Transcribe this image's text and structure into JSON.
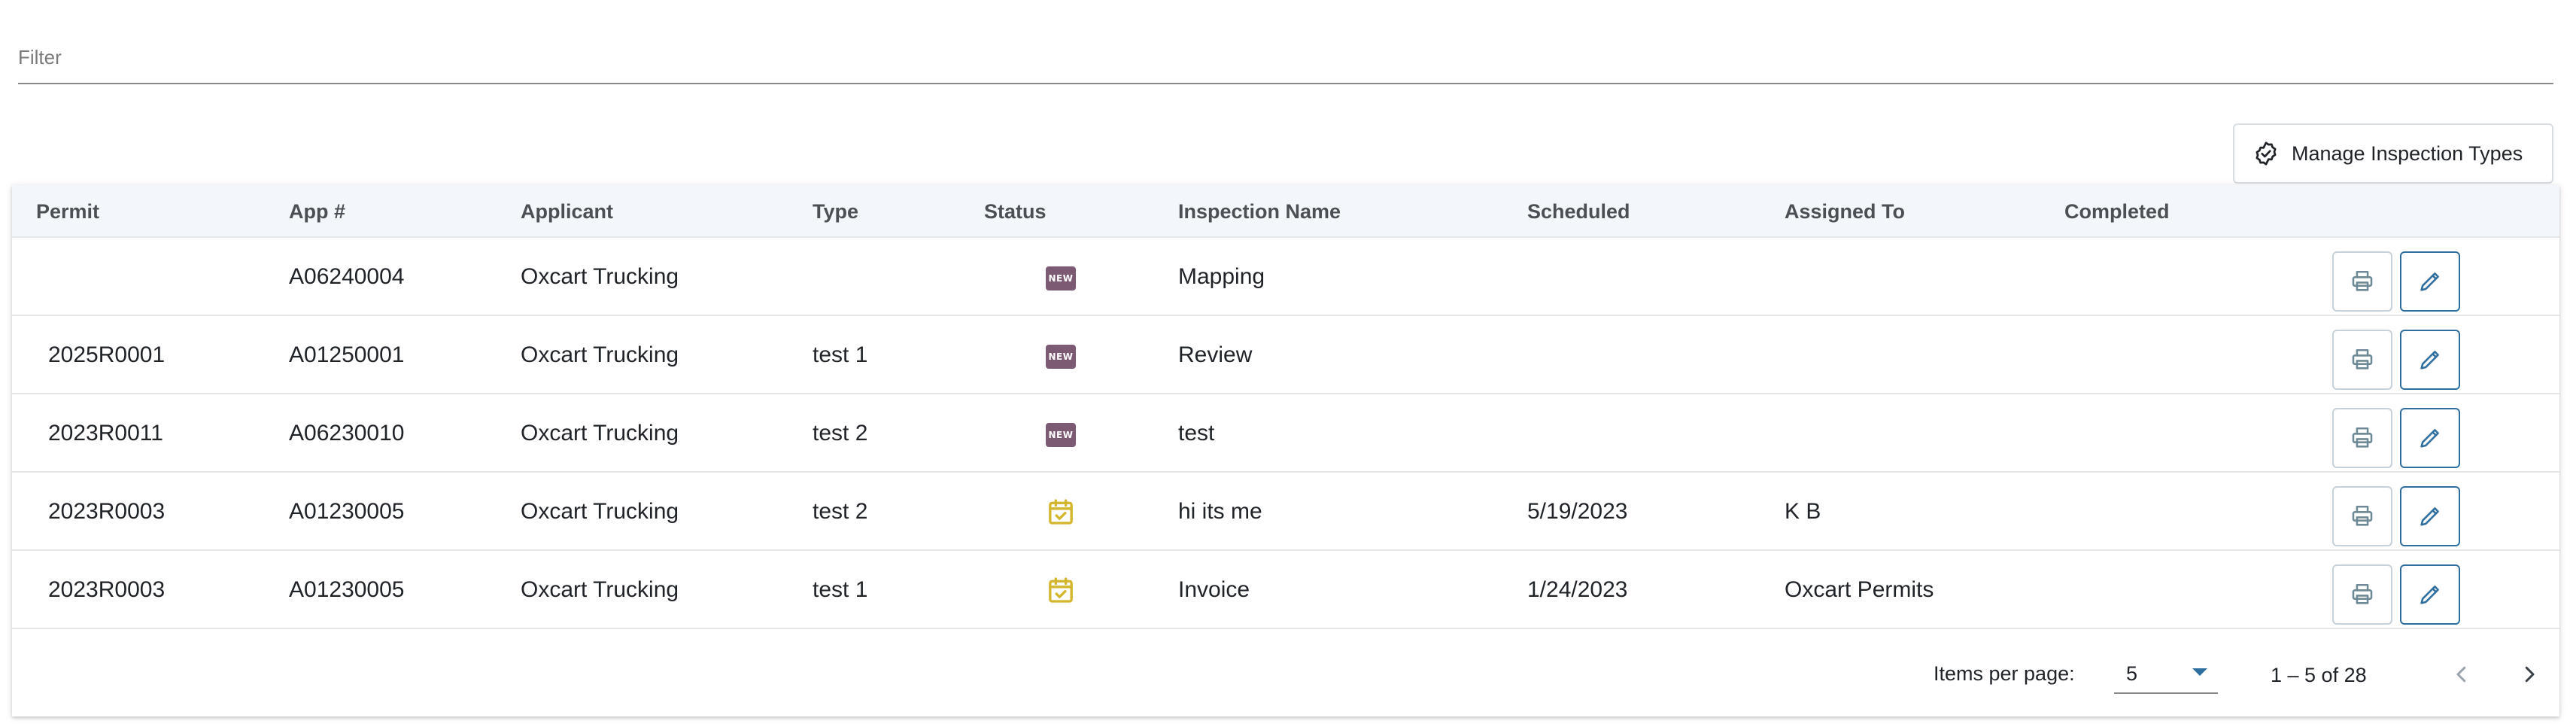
{
  "filter": {
    "placeholder": "Filter",
    "value": ""
  },
  "manage_button": {
    "label": "Manage Inspection Types",
    "icon": "check-badge-icon"
  },
  "table": {
    "columns": [
      "Permit",
      "App #",
      "Applicant",
      "Type",
      "Status",
      "Inspection Name",
      "Scheduled",
      "Assigned To",
      "Completed"
    ],
    "rows": [
      {
        "permit": "",
        "app": "A06240004",
        "applicant": "Oxcart Trucking",
        "type": "",
        "status": "new",
        "inspection_name": "Mapping",
        "scheduled": "",
        "assigned_to": "",
        "completed": ""
      },
      {
        "permit": "2025R0001",
        "app": "A01250001",
        "applicant": "Oxcart Trucking",
        "type": "test 1",
        "status": "new",
        "inspection_name": "Review",
        "scheduled": "",
        "assigned_to": "",
        "completed": ""
      },
      {
        "permit": "2023R0011",
        "app": "A06230010",
        "applicant": "Oxcart Trucking",
        "type": "test 2",
        "status": "new",
        "inspection_name": "test",
        "scheduled": "",
        "assigned_to": "",
        "completed": ""
      },
      {
        "permit": "2023R0003",
        "app": "A01230005",
        "applicant": "Oxcart Trucking",
        "type": "test 2",
        "status": "scheduled",
        "inspection_name": "hi its me",
        "scheduled": "5/19/2023",
        "assigned_to": "K B",
        "completed": ""
      },
      {
        "permit": "2023R0003",
        "app": "A01230005",
        "applicant": "Oxcart Trucking",
        "type": "test 1",
        "status": "scheduled",
        "inspection_name": "Invoice",
        "scheduled": "1/24/2023",
        "assigned_to": "Oxcart Permits",
        "completed": ""
      }
    ],
    "new_badge_text": "NEW",
    "actions": {
      "print_icon": "print-icon",
      "edit_icon": "pencil-icon"
    }
  },
  "paginator": {
    "items_per_page_label": "Items per page:",
    "items_per_page": "5",
    "range_label": "1 – 5 of 28",
    "prev_icon": "chevron-left-icon",
    "next_icon": "chevron-right-icon"
  },
  "colors": {
    "new_badge": "#7d5a73",
    "scheduled_icon": "#d4b62c",
    "accent": "#2f6fa0",
    "header_bg": "#f3f7fb"
  }
}
